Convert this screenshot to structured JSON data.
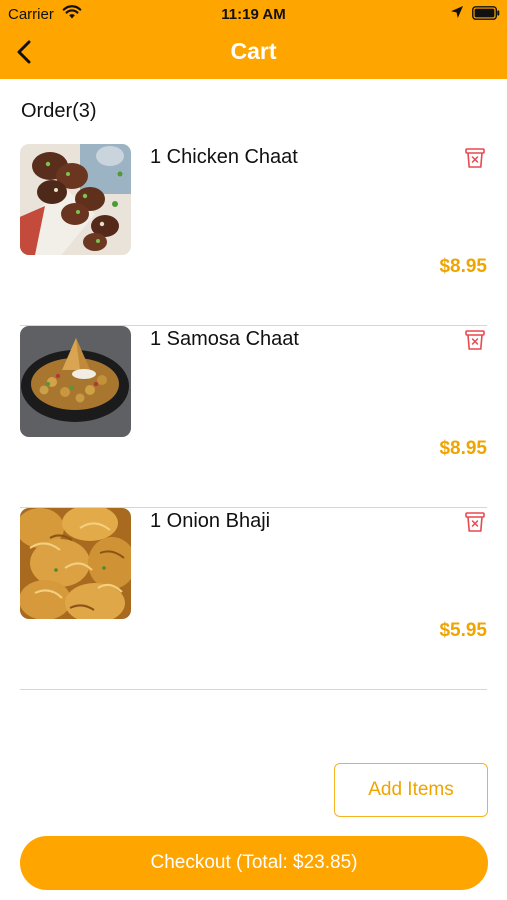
{
  "status_bar": {
    "carrier": "Carrier",
    "time": "11:19 AM",
    "icons": [
      "wifi-icon",
      "location-arrow-icon",
      "battery-icon"
    ]
  },
  "nav": {
    "title": "Cart",
    "back_icon": "chevron-left-icon"
  },
  "order": {
    "title": "Order(3)",
    "items": [
      {
        "name": "1 Chicken Chaat",
        "price": "$8.95",
        "image": "chicken-chaat-photo",
        "delete_icon": "trash-icon"
      },
      {
        "name": "1 Samosa Chaat",
        "price": "$8.95",
        "image": "samosa-chaat-photo",
        "delete_icon": "trash-icon"
      },
      {
        "name": "1 Onion Bhaji",
        "price": "$5.95",
        "image": "onion-bhaji-photo",
        "delete_icon": "trash-icon"
      }
    ]
  },
  "actions": {
    "add_items_label": "Add Items",
    "checkout_label": "Checkout (Total: $23.85)"
  },
  "colors": {
    "brand": "#FFA500",
    "price": "#F0A400",
    "delete": "#E8494F"
  }
}
